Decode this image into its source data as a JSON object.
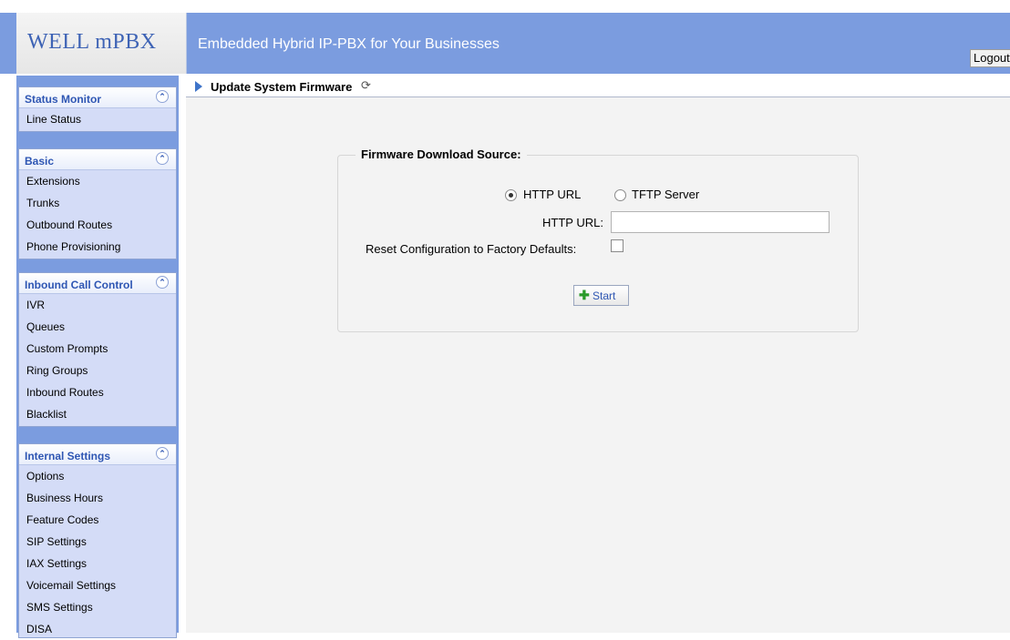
{
  "header": {
    "logo": "WELL mPBX",
    "tagline": "Embedded Hybrid IP-PBX for Your Businesses",
    "logout_label": "Logout"
  },
  "sidebar": {
    "sections": [
      {
        "title": "Status Monitor",
        "items": [
          "Line Status"
        ]
      },
      {
        "title": "Basic",
        "items": [
          "Extensions",
          "Trunks",
          "Outbound Routes",
          "Phone Provisioning"
        ]
      },
      {
        "title": "Inbound Call Control",
        "items": [
          "IVR",
          "Queues",
          "Custom Prompts",
          "Ring Groups",
          "Inbound Routes",
          "Blacklist"
        ]
      },
      {
        "title": "Internal Settings",
        "items": [
          "Options",
          "Business Hours",
          "Feature Codes",
          "SIP Settings",
          "IAX Settings",
          "Voicemail Settings",
          "SMS Settings",
          "DISA"
        ]
      }
    ],
    "collapse_icon": "double-chevron-up-icon"
  },
  "main": {
    "page_title": "Update System Firmware",
    "refresh_icon": "refresh-icon",
    "legend": "Firmware Download Source:",
    "source_options": [
      {
        "label": "HTTP URL",
        "selected": true
      },
      {
        "label": "TFTP Server",
        "selected": false
      }
    ],
    "http_url_label": "HTTP URL:",
    "http_url_value": "",
    "reset_label": "Reset Configuration to Factory Defaults:",
    "reset_checked": false,
    "start_label": "Start",
    "start_icon": "plus-icon"
  },
  "colors": {
    "header_bg": "#7b9cdf",
    "panel_title": "#2e56b3",
    "panel_bg": "#d4dcf7"
  }
}
